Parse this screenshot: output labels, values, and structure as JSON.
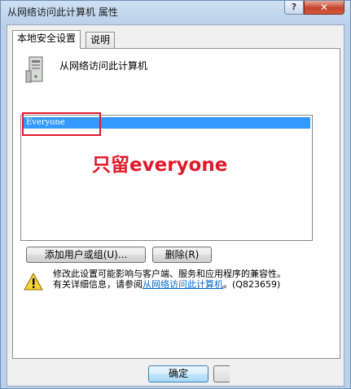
{
  "window": {
    "title": "从网络访问此计算机 属性",
    "help_label": "?",
    "close_label": "✕"
  },
  "tabs": [
    {
      "label": "本地安全设置"
    },
    {
      "label": "说明"
    }
  ],
  "policy": {
    "name": "从网络访问此计算机",
    "icon": "computer-tower-icon"
  },
  "list": {
    "items": [
      {
        "label": "Everyone",
        "selected": true
      }
    ]
  },
  "annotation": {
    "text": "只留everyone",
    "color": "#e2192b"
  },
  "buttons": {
    "add": "添加用户或组(U)...",
    "remove": "删除(R)",
    "ok": "确定"
  },
  "warning": {
    "icon": "warning-icon",
    "line1": "修改此设置可能影响与客户端、服务和应用程序的兼容性。",
    "line2_prefix": "有关详细信息，请参阅",
    "link": "从网络访问此计算机",
    "line2_suffix": "。(Q823659)"
  }
}
